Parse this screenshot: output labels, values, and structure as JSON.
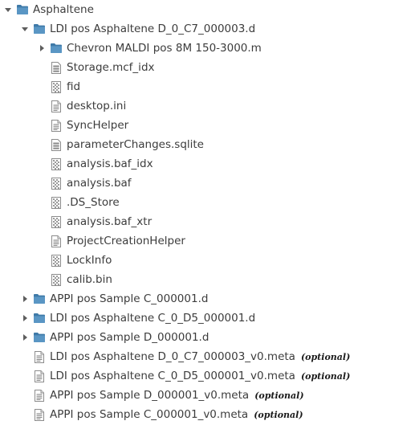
{
  "colors": {
    "folder": "#5a96c4",
    "folder_dark": "#3f7aa8",
    "text": "#3c3c3c",
    "arrow": "#5e5e5e"
  },
  "tree": [
    {
      "label": "Asphaltene",
      "icon": "folder-icon",
      "arrow": "expanded",
      "depth": 0
    },
    {
      "label": "LDI pos Asphaltene D_0_C7_000003.d",
      "icon": "folder-icon",
      "arrow": "expanded",
      "depth": 1
    },
    {
      "label": "Chevron MALDI pos 8M 150-3000.m",
      "icon": "folder-icon",
      "arrow": "collapsed",
      "depth": 2
    },
    {
      "label": "Storage.mcf_idx",
      "icon": "database-file-icon",
      "arrow": "none",
      "depth": 2
    },
    {
      "label": "fid",
      "icon": "binary-file-icon",
      "arrow": "none",
      "depth": 2
    },
    {
      "label": "desktop.ini",
      "icon": "text-file-icon",
      "arrow": "none",
      "depth": 2
    },
    {
      "label": "SyncHelper",
      "icon": "text-file-icon",
      "arrow": "none",
      "depth": 2
    },
    {
      "label": "parameterChanges.sqlite",
      "icon": "database-file-icon",
      "arrow": "none",
      "depth": 2
    },
    {
      "label": "analysis.baf_idx",
      "icon": "binary-file-icon",
      "arrow": "none",
      "depth": 2
    },
    {
      "label": "analysis.baf",
      "icon": "binary-file-icon",
      "arrow": "none",
      "depth": 2
    },
    {
      "label": ".DS_Store",
      "icon": "binary-file-icon",
      "arrow": "none",
      "depth": 2
    },
    {
      "label": "analysis.baf_xtr",
      "icon": "binary-file-icon",
      "arrow": "none",
      "depth": 2
    },
    {
      "label": "ProjectCreationHelper",
      "icon": "text-file-icon",
      "arrow": "none",
      "depth": 2
    },
    {
      "label": "LockInfo",
      "icon": "binary-file-icon",
      "arrow": "none",
      "depth": 2
    },
    {
      "label": "calib.bin",
      "icon": "binary-file-icon",
      "arrow": "none",
      "depth": 2
    },
    {
      "label": "APPI pos Sample C_000001.d",
      "icon": "folder-icon",
      "arrow": "collapsed",
      "depth": 1
    },
    {
      "label": "LDI pos Asphaltene C_0_D5_000001.d",
      "icon": "folder-icon",
      "arrow": "collapsed",
      "depth": 1
    },
    {
      "label": "APPI pos Sample D_000001.d",
      "icon": "folder-icon",
      "arrow": "collapsed",
      "depth": 1
    },
    {
      "label": "LDI pos Asphaltene D_0_C7_000003_v0.meta",
      "icon": "text-file-icon",
      "arrow": "none",
      "depth": 1,
      "note": "(optional)"
    },
    {
      "label": "LDI pos Asphaltene C_0_D5_000001_v0.meta",
      "icon": "text-file-icon",
      "arrow": "none",
      "depth": 1,
      "note": "(optional)"
    },
    {
      "label": "APPI pos Sample D_000001_v0.meta",
      "icon": "text-file-icon",
      "arrow": "none",
      "depth": 1,
      "note": "(optional)"
    },
    {
      "label": "APPI pos Sample C_000001_v0.meta",
      "icon": "text-file-icon",
      "arrow": "none",
      "depth": 1,
      "note": "(optional)"
    }
  ]
}
